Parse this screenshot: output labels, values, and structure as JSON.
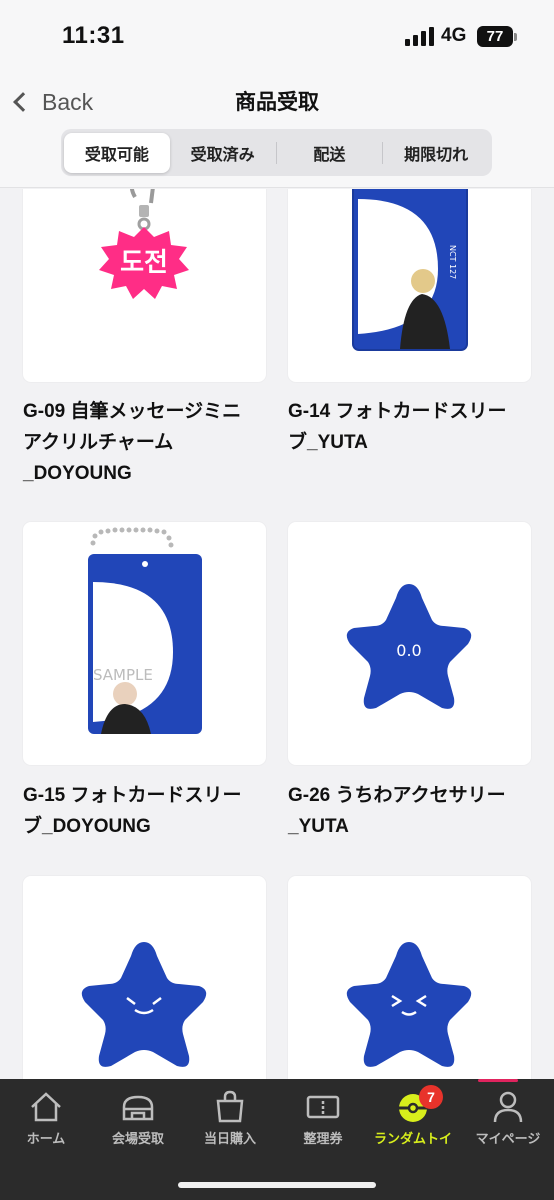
{
  "status_bar": {
    "time": "11:31",
    "network": "4G",
    "battery": "77"
  },
  "nav": {
    "back_label": "Back",
    "title": "商品受取"
  },
  "segments": [
    {
      "label": "受取可能",
      "active": true
    },
    {
      "label": "受取済み",
      "active": false
    },
    {
      "label": "配送",
      "active": false
    },
    {
      "label": "期限切れ",
      "active": false
    }
  ],
  "products": [
    {
      "name": "G-09 自筆メッセージミニアクリルチャーム_DOYOUNG",
      "lines": [
        "G-09 自筆メッセージミニ",
        "アクリルチャーム",
        "_DOYOUNG"
      ],
      "image": "acrylic-charm",
      "charm_text": "도전"
    },
    {
      "name": "G-14 フォトカードスリーブ_YUTA",
      "lines": [
        "G-14 フォトカードスリー",
        "ブ_YUTA"
      ],
      "image": "photocard-sleeve"
    },
    {
      "name": "G-15 フォトカードスリーブ_DOYOUNG",
      "lines": [
        "G-15 フォトカードスリー",
        "ブ_DOYOUNG"
      ],
      "image": "photocard-sleeve",
      "sleeve_text": "SAMPLE"
    },
    {
      "name": "G-26 うちわアクセサリー_YUTA",
      "lines": [
        "G-26 うちわアクセサリー",
        "_YUTA"
      ],
      "image": "star-accessory"
    },
    {
      "name": "",
      "lines": [],
      "image": "star-accessory"
    },
    {
      "name": "",
      "lines": [],
      "image": "star-accessory"
    }
  ],
  "tabbar": {
    "items": [
      {
        "label": "ホーム",
        "icon": "home-icon"
      },
      {
        "label": "会場受取",
        "icon": "venue-icon"
      },
      {
        "label": "当日購入",
        "icon": "shopping-bag-icon"
      },
      {
        "label": "整理券",
        "icon": "ticket-icon"
      },
      {
        "label": "ランダムトイ",
        "icon": "random-toy-icon",
        "active": true,
        "badge": "7"
      },
      {
        "label": "マイページ",
        "icon": "person-icon"
      }
    ]
  },
  "colors": {
    "accent": "#d8ee1c",
    "brand_blue": "#2146b8",
    "charm_pink": "#ff2d86",
    "badge_red": "#e8332b"
  }
}
